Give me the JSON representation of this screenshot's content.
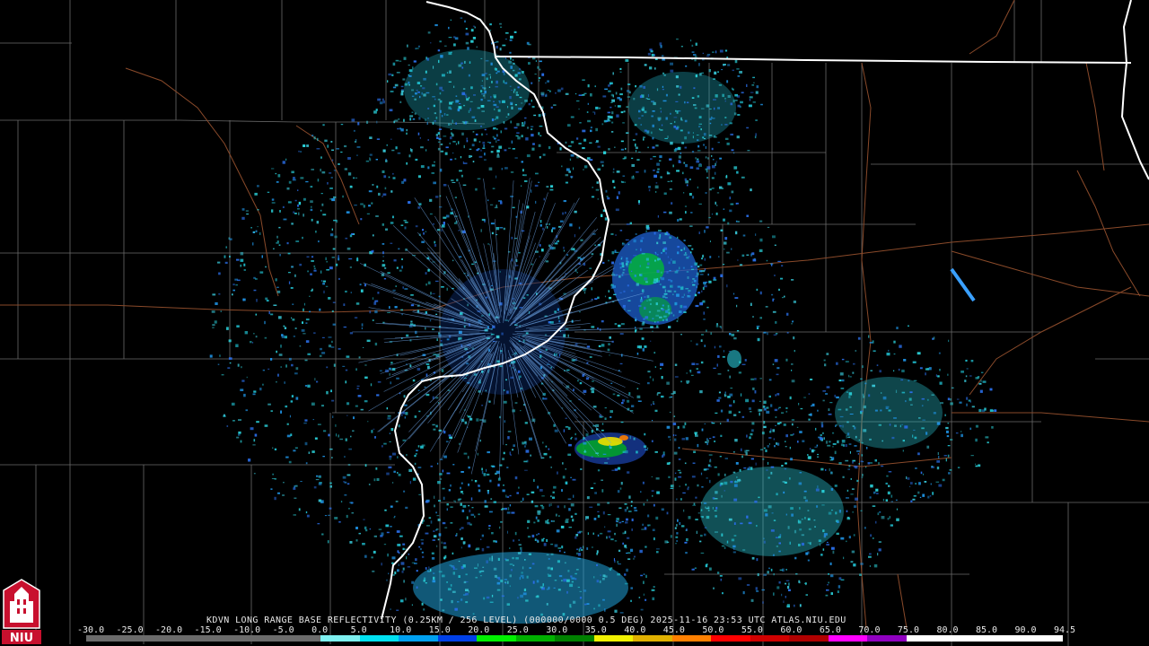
{
  "caption": {
    "station": "KDVN",
    "product": "LONG RANGE BASE REFLECTIVITY",
    "resolution": "(0.25KM / 256 LEVEL)",
    "volume": "(000000/0000",
    "elevation": "0.5 DEG)",
    "datetime": "2025-11-16 23:53 UTC",
    "source": "ATLAS.NIU.EDU"
  },
  "scale": {
    "labels": [
      "-30.0",
      "-25.0",
      "-20.0",
      "-15.0",
      "-10.0",
      "-5.0",
      "0.0",
      "5.0",
      "10.0",
      "15.0",
      "20.0",
      "25.0",
      "30.0",
      "35.0",
      "40.0",
      "45.0",
      "50.0",
      "55.0",
      "60.0",
      "65.0",
      "70.0",
      "75.0",
      "80.0",
      "85.0",
      "90.0",
      "94.5"
    ],
    "colors": [
      "#6b6b6b",
      "#6b6b6b",
      "#6b6b6b",
      "#6b6b6b",
      "#6b6b6b",
      "#6b6b6b",
      "#7ef0f0",
      "#00e0f0",
      "#00a0f0",
      "#0040e8",
      "#00f000",
      "#00b000",
      "#008000",
      "#f0f000",
      "#e0b000",
      "#ff8000",
      "#ff0000",
      "#d00000",
      "#b00000",
      "#ff00ff",
      "#9000c0",
      "#ffffff",
      "#ffffff",
      "#ffffff",
      "#ffffff"
    ]
  },
  "logo": {
    "text": "NIU"
  }
}
